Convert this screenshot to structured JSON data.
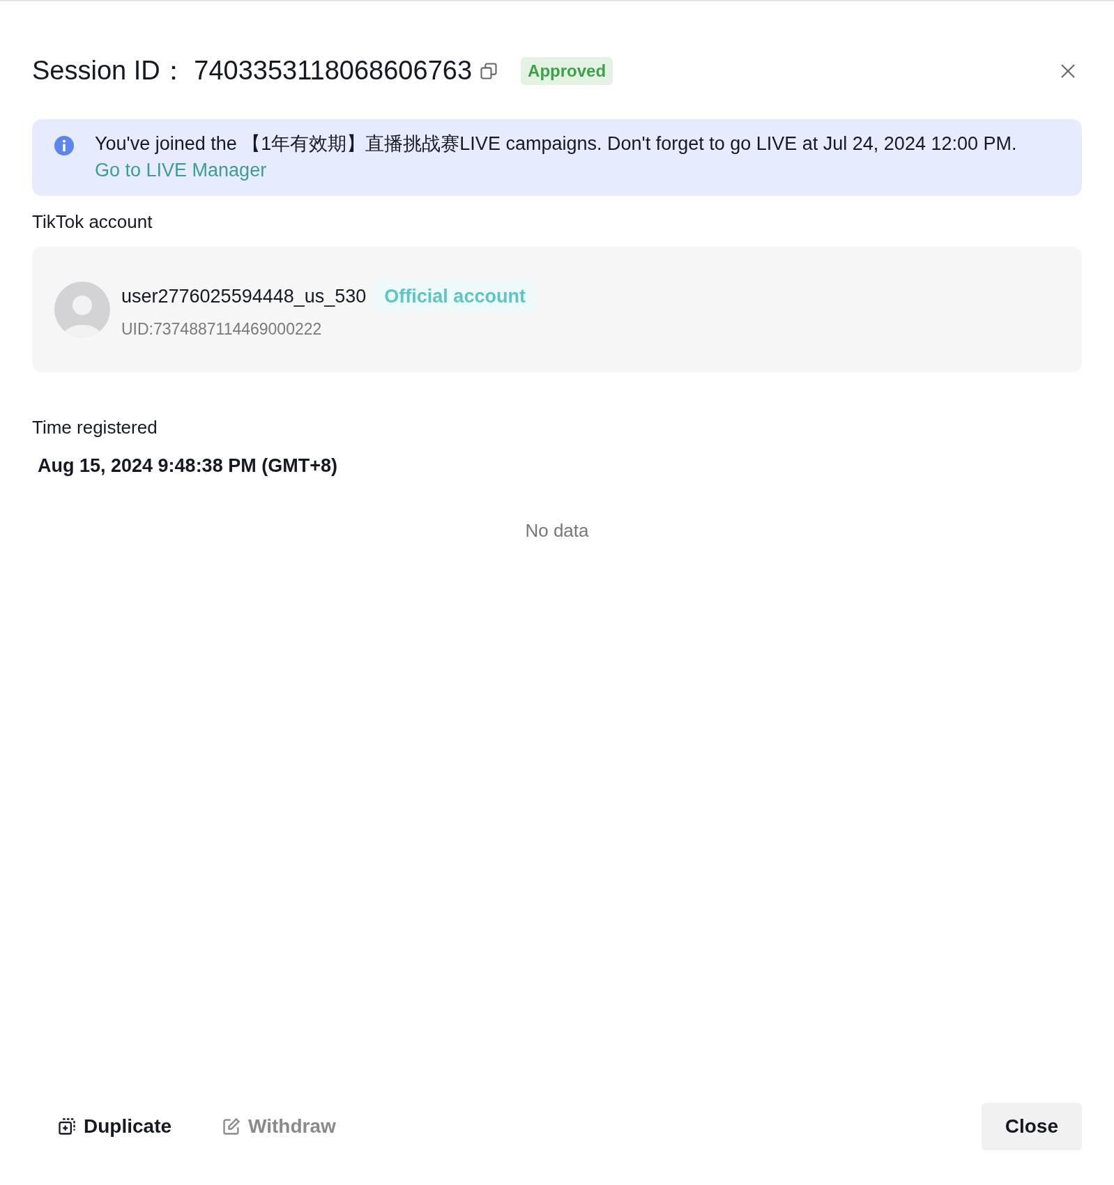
{
  "header": {
    "label": "Session ID：",
    "session_id": "7403353118068606763",
    "status": "Approved"
  },
  "notice": {
    "text": "You've joined the 【1年有效期】直播挑战赛LIVE campaigns. Don't forget to go LIVE at Jul 24, 2024 12:00 PM.",
    "link": "Go to LIVE Manager"
  },
  "account": {
    "label": "TikTok account",
    "username": "user2776025594448_us_530",
    "badge": "Official account",
    "uid": "UID:7374887114469000222"
  },
  "registered": {
    "label": "Time registered",
    "value": "Aug 15, 2024 9:48:38 PM (GMT+8)"
  },
  "empty_text": "No data",
  "footer": {
    "actions": [
      {
        "kind": "duplicate",
        "label": "Duplicate",
        "disabled": false
      },
      {
        "kind": "withdraw",
        "label": "Withdraw",
        "disabled": true
      }
    ],
    "close": "Close"
  }
}
